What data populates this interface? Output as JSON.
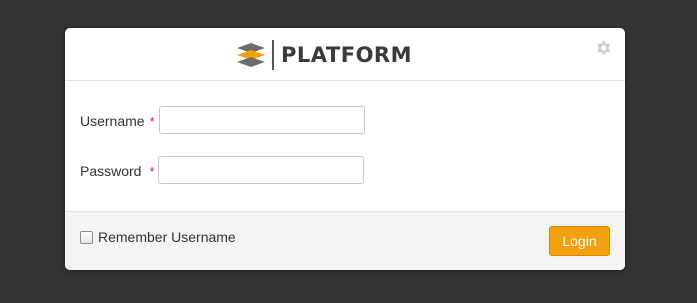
{
  "header": {
    "logo_text": "PLATFORM",
    "logo_icon": "platform-logo-icon",
    "settings_icon": "gear-icon"
  },
  "form": {
    "username": {
      "label": "Username",
      "required_marker": "*",
      "value": "",
      "placeholder": ""
    },
    "password": {
      "label": "Password",
      "required_marker": "*",
      "value": "",
      "placeholder": ""
    }
  },
  "footer": {
    "remember_label": "Remember Username",
    "remember_checked": false,
    "login_label": "Login"
  },
  "colors": {
    "background": "#333333",
    "accent": "#f5a10f",
    "required": "#d9261c",
    "logo_text": "#3a3a3a"
  }
}
